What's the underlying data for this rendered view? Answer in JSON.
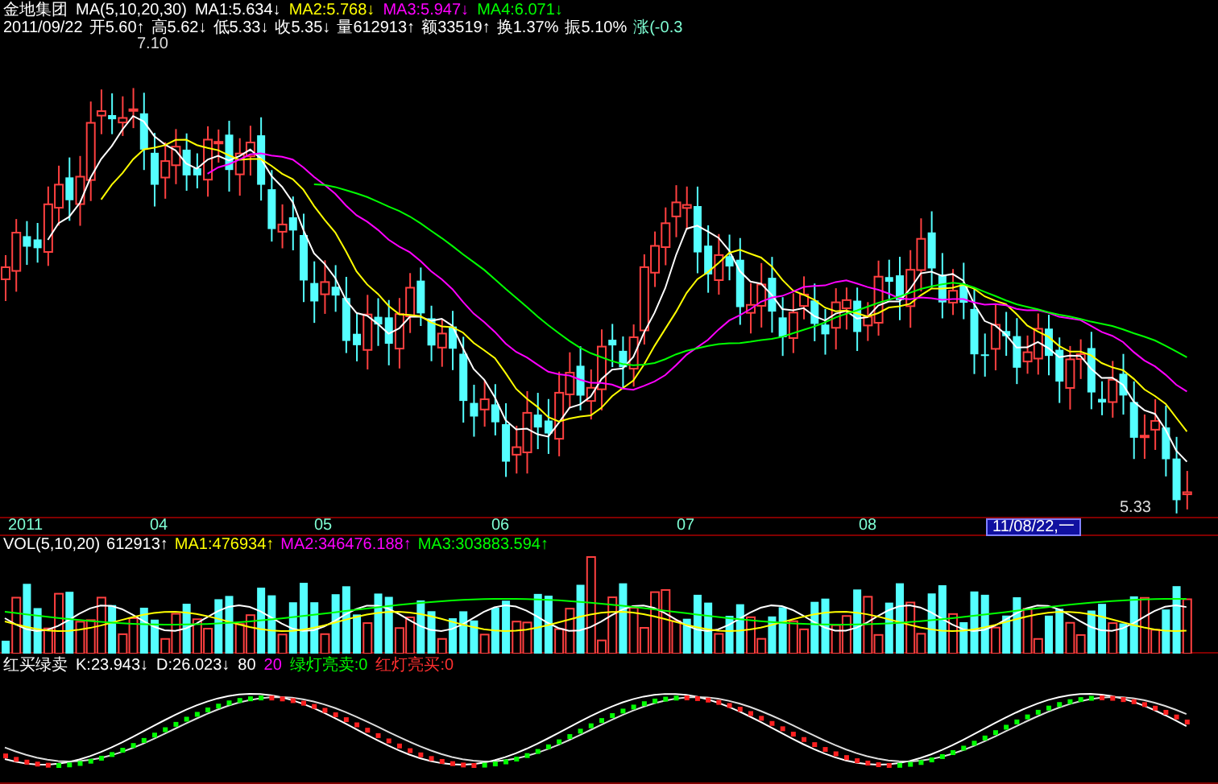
{
  "header": {
    "stock": "金地集团",
    "ma_label": "MA(5,10,20,30)",
    "items": [
      {
        "text": "MA1:5.634↓",
        "color": "#ffffff"
      },
      {
        "text": "MA2:5.768↓",
        "color": "#ffff00"
      },
      {
        "text": "MA3:5.947↓",
        "color": "#ff00ff"
      },
      {
        "text": "MA4:6.071↓",
        "color": "#00ff00"
      }
    ]
  },
  "quote": {
    "date": "2011/09/22",
    "items": [
      {
        "text": "开5.60↑",
        "color": "#ffffff"
      },
      {
        "text": "高5.62↓",
        "color": "#ffffff"
      },
      {
        "text": "低5.33↓",
        "color": "#ffffff"
      },
      {
        "text": "收5.35↓",
        "color": "#ffffff"
      },
      {
        "text": "量612913↑",
        "color": "#ffffff"
      },
      {
        "text": "额33519↑",
        "color": "#ffffff"
      },
      {
        "text": "换1.37%",
        "color": "#ffffff"
      },
      {
        "text": "振5.10%",
        "color": "#ffffff"
      },
      {
        "text": "涨(-0.3",
        "color": "#7fffd4"
      }
    ]
  },
  "price_labels": {
    "high": "7.10",
    "low": "5.33"
  },
  "date_axis": {
    "labels": [
      "2011",
      "04",
      "05",
      "06",
      "07",
      "08"
    ],
    "cursor_date": "11/08/22,一"
  },
  "volume": {
    "label": "VOL(5,10,20)",
    "items": [
      {
        "text": "612913↑",
        "color": "#ffffff"
      },
      {
        "text": "MA1:476934↑",
        "color": "#ffff00"
      },
      {
        "text": "MA2:346476.188↑",
        "color": "#ff00ff"
      },
      {
        "text": "MA3:303883.594↑",
        "color": "#00ff00"
      }
    ]
  },
  "indicator": {
    "name": "红买绿卖",
    "items": [
      {
        "text": "K:23.943↓",
        "color": "#ffffff"
      },
      {
        "text": "D:26.023↓",
        "color": "#ffffff"
      },
      {
        "text": "80",
        "color": "#ffffff"
      },
      {
        "text": "20",
        "color": "#ff00ff"
      },
      {
        "text": "绿灯亮卖:0",
        "color": "#00ff00"
      },
      {
        "text": "红灯亮买:0",
        "color": "#ff3030"
      }
    ]
  }
}
